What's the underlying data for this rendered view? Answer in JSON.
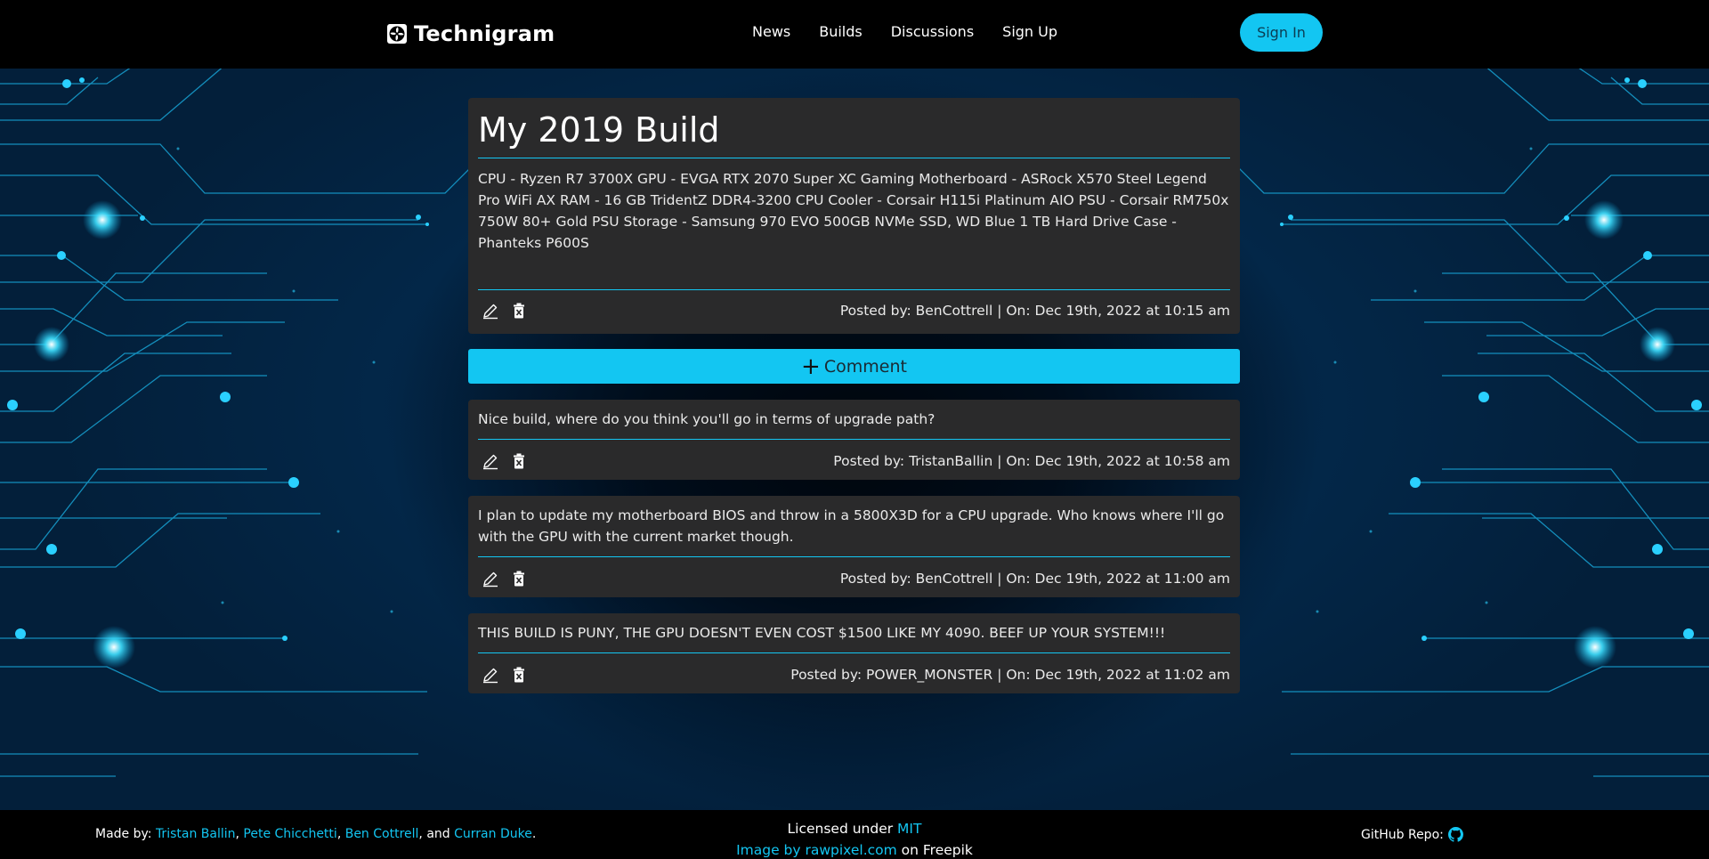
{
  "header": {
    "brand": "Technigram",
    "nav": [
      "News",
      "Builds",
      "Discussions",
      "Sign Up"
    ],
    "signin_label": "Sign In"
  },
  "post": {
    "title": "My 2019 Build",
    "body": "CPU - Ryzen R7 3700X GPU - EVGA RTX 2070 Super XC Gaming Motherboard - ASRock X570 Steel Legend Pro WiFi AX RAM - 16 GB TridentZ DDR4-3200 CPU Cooler - Corsair H115i Platinum AIO PSU - Corsair RM750x 750W 80+ Gold PSU Storage - Samsung 970 EVO 500GB NVMe SSD, WD Blue 1 TB Hard Drive Case - Phanteks P600S",
    "meta": "Posted by: BenCottrell | On: Dec 19th, 2022 at 10:15 am"
  },
  "comment_button": {
    "label": "Comment"
  },
  "comments": [
    {
      "text": "Nice build, where do you think you'll go in terms of upgrade path?",
      "meta": "Posted by: TristanBallin | On: Dec 19th, 2022 at 10:58 am"
    },
    {
      "text": "I plan to update my motherboard BIOS and throw in a 5800X3D for a CPU upgrade. Who knows where I'll go with the GPU with the current market though.",
      "meta": "Posted by: BenCottrell | On: Dec 19th, 2022 at 11:00 am"
    },
    {
      "text": "THIS BUILD IS PUNY, THE GPU DOESN'T EVEN COST $1500 LIKE MY 4090. BEEF UP YOUR SYSTEM!!!",
      "meta": "Posted by: POWER_MONSTER | On: Dec 19th, 2022 at 11:02 am"
    }
  ],
  "footer": {
    "made_by_prefix": "Made by: ",
    "authors": [
      "Tristan Ballin",
      "Pete Chicchetti",
      "Ben Cottrell",
      "Curran Duke"
    ],
    "sep1": ", ",
    "sep2": ", ",
    "sep3": ", and ",
    "end": ".",
    "licensed_prefix": "Licensed under ",
    "license": "MIT",
    "image_credit_link": "Image by rawpixel.com",
    "image_credit_suffix": " on Freepik",
    "repo_label": "GitHub Repo:"
  },
  "icons": {
    "brand": "fan-icon",
    "edit": "pencil-icon",
    "delete": "trash-icon",
    "github": "github-icon"
  },
  "colors": {
    "accent": "#13c6f2",
    "card": "#2a2a2b",
    "topbar": "#000000",
    "background": "#031e38"
  }
}
